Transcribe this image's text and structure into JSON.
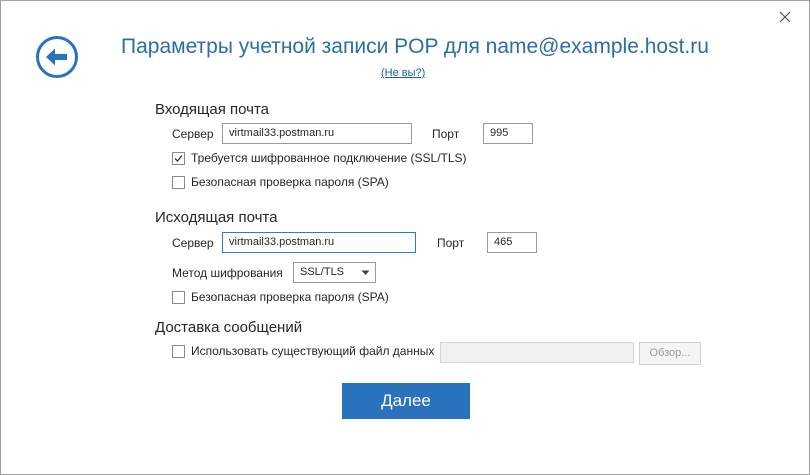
{
  "header": {
    "title": "Параметры учетной записи POP для name@example.host.ru",
    "not_you_link": "(Не вы?)"
  },
  "incoming": {
    "section_title": "Входящая почта",
    "server_label": "Сервер",
    "server_value": "virtmail33.postman.ru",
    "port_label": "Порт",
    "port_value": "995",
    "ssl_checkbox": {
      "label": "Требуется шифрованное подключение (SSL/TLS)",
      "checked": true
    },
    "spa_checkbox": {
      "label": "Безопасная проверка пароля (SPA)",
      "checked": false
    }
  },
  "outgoing": {
    "section_title": "Исходящая почта",
    "server_label": "Сервер",
    "server_value": "virtmail33.postman.ru",
    "port_label": "Порт",
    "port_value": "465",
    "encryption_label": "Метод шифрования",
    "encryption_value": "SSL/TLS",
    "spa_checkbox": {
      "label": "Безопасная проверка пароля (SPA)",
      "checked": false
    }
  },
  "delivery": {
    "section_title": "Доставка сообщений",
    "existing_file_checkbox": {
      "label": "Использовать существующий файл данных",
      "checked": false
    },
    "data_file_value": "",
    "browse_label": "Обзор..."
  },
  "footer": {
    "next_label": "Далее"
  },
  "icons": {
    "back": "back-arrow-icon",
    "close": "close-icon",
    "check": "checkmark-icon",
    "dropdown": "chevron-down-icon"
  },
  "colors": {
    "accent": "#2b72bd",
    "title": "#2a6ea8",
    "link": "#1a5fa5"
  }
}
